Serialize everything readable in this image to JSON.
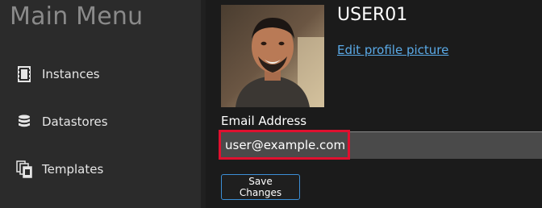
{
  "sidebar": {
    "title": "Main Menu",
    "items": [
      {
        "label": "Instances",
        "icon": "film-strip-icon"
      },
      {
        "label": "Datastores",
        "icon": "database-icon"
      },
      {
        "label": "Templates",
        "icon": "templates-icon"
      }
    ]
  },
  "profile": {
    "username": "USER01",
    "edit_picture_label": "Edit profile picture",
    "email_label": "Email Address",
    "email_value": "user@example.com",
    "save_label": "Save Changes"
  },
  "colors": {
    "highlight": "#e0102f",
    "link": "#5aa9e6",
    "button_border": "#3c8fd6"
  }
}
